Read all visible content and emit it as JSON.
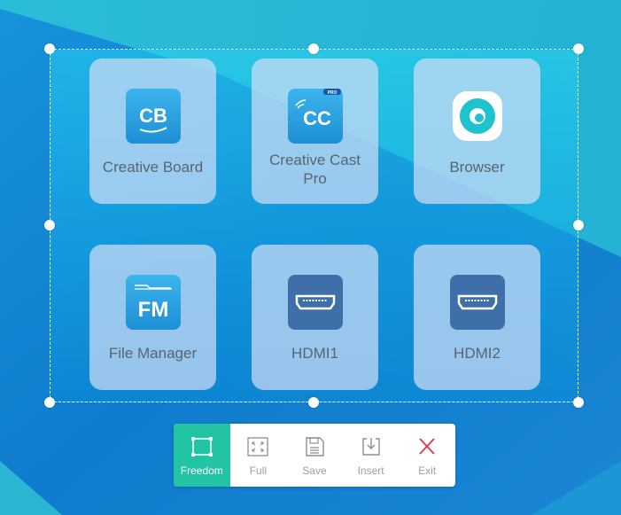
{
  "apps": [
    {
      "name": "Creative Board",
      "icon": "creative-board-icon",
      "badge": "CB"
    },
    {
      "name": "Creative Cast Pro",
      "icon": "creative-cast-icon",
      "badge": "CC",
      "tag": "PRO"
    },
    {
      "name": "Browser",
      "icon": "browser-icon"
    },
    {
      "name": "File Manager",
      "icon": "file-manager-icon",
      "badge": "FM"
    },
    {
      "name": "HDMI1",
      "icon": "hdmi-icon"
    },
    {
      "name": "HDMI2",
      "icon": "hdmi-icon"
    }
  ],
  "toolbar": {
    "freedom": "Freedom",
    "full": "Full",
    "save": "Save",
    "insert": "Insert",
    "exit": "Exit",
    "active_color": "#22c4a4",
    "exit_color": "#e8304a"
  }
}
